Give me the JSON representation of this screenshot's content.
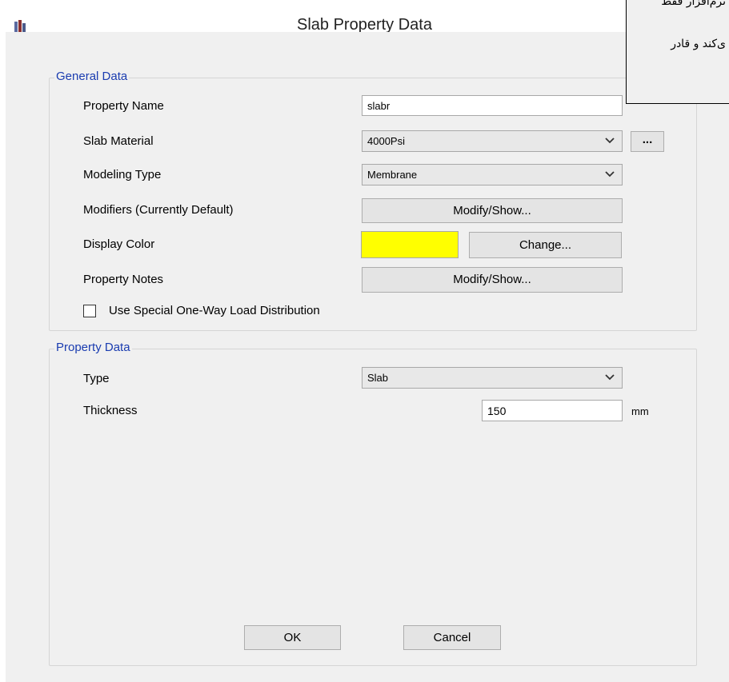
{
  "window": {
    "title": "Slab Property Data"
  },
  "general": {
    "label": "General Data",
    "property_name": {
      "label": "Property Name",
      "value": "slabr"
    },
    "slab_material": {
      "label": "Slab Material",
      "value": "4000Psi",
      "browse_label": "..."
    },
    "modeling_type": {
      "label": "Modeling Type",
      "value": "Membrane"
    },
    "modifiers": {
      "label": "Modifiers (Currently Default)",
      "button": "Modify/Show..."
    },
    "display_color": {
      "label": "Display Color",
      "color": "#ffff00",
      "button": "Change..."
    },
    "property_notes": {
      "label": "Property Notes",
      "button": "Modify/Show..."
    },
    "one_way": {
      "label": "Use Special One-Way Load Distribution",
      "checked": false
    }
  },
  "property_data": {
    "label": "Property Data",
    "type": {
      "label": "Type",
      "value": "Slab"
    },
    "thickness": {
      "label": "Thickness",
      "value": "150",
      "unit": "mm"
    }
  },
  "footer": {
    "ok": "OK",
    "cancel": "Cancel"
  },
  "tooltip": {
    "line1": "نرم‌افزار فقط",
    "line2": "ی‌کند و قادر"
  }
}
